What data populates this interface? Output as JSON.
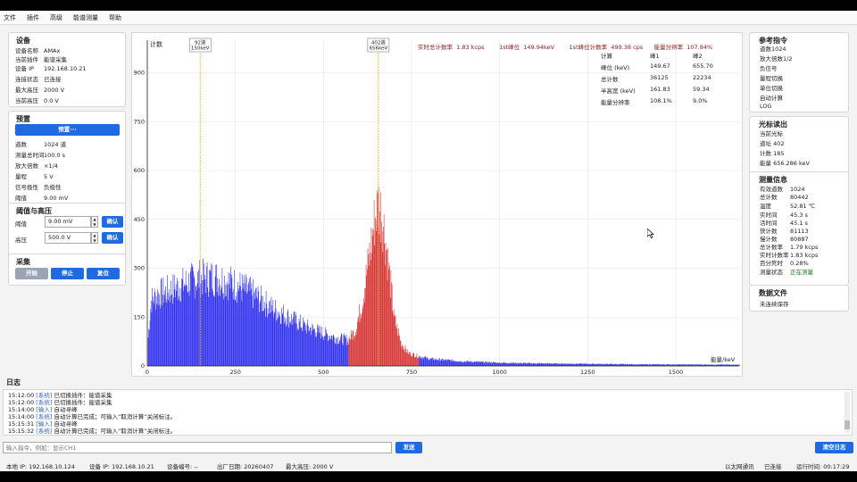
{
  "menu": [
    "文件",
    "插件",
    "高级",
    "能谱测量",
    "帮助"
  ],
  "device": {
    "title": "设备",
    "rows": [
      {
        "k": "设备名称",
        "v": "AMAx"
      },
      {
        "k": "当前插件",
        "v": "能谱采集"
      },
      {
        "k": "设备 IP",
        "v": "192.168.10.21"
      },
      {
        "k": "连接状态",
        "v": "已连接"
      },
      {
        "k": "最大高压",
        "v": "2000 V"
      },
      {
        "k": "当前高压",
        "v": "0.0 V"
      }
    ]
  },
  "preset": {
    "title": "预置",
    "button": "预置···",
    "rows": [
      {
        "k": "道数",
        "v": "1024 道"
      },
      {
        "k": "测量总时间",
        "v": "100.0 s"
      },
      {
        "k": "放大倍数",
        "v": "×1/4"
      },
      {
        "k": "量程",
        "v": "5 V"
      },
      {
        "k": "信号极性",
        "v": "负极性"
      },
      {
        "k": "阈值",
        "v": "9.00 mV"
      }
    ]
  },
  "threshold": {
    "title": "阈值与高压",
    "thr_label": "阈值",
    "thr_value": "9.00 mV",
    "hv_label": "高压",
    "hv_value": "500.0 V",
    "confirm": "确认"
  },
  "acquire": {
    "title": "采集",
    "start": "开始",
    "stop": "停止",
    "reset": "复位"
  },
  "chart_header": {
    "rate_label": "实时总计数率",
    "rate_value": "1.83 kcps",
    "peak1_label": "1st峰位",
    "peak1_value": "149.94keV",
    "count1_label": "1st峰位计数率",
    "count1_value": "499.38 cps",
    "res_label": "能量分辨率",
    "res_value": "107.84%"
  },
  "peak_table": {
    "headers": [
      "计算",
      "峰1",
      "峰2"
    ],
    "rows": [
      [
        "峰位 (keV)",
        "149.67",
        "655.70"
      ],
      [
        "总计数",
        "36125",
        "22234"
      ],
      [
        "半高宽 (keV)",
        "161.83",
        "59.34"
      ],
      [
        "能量分辨率",
        "108.1%",
        "9.0%"
      ]
    ]
  },
  "markers": [
    {
      "channel_label": "92道",
      "energy_label": "150keV",
      "energy": 150
    },
    {
      "channel_label": "402道",
      "energy_label": "656keV",
      "energy": 656
    }
  ],
  "chart_data": {
    "type": "bar",
    "ylabel": "计数",
    "xlabel": "能量/keV",
    "xlim": [
      0,
      1680
    ],
    "ylim": [
      0,
      1000
    ],
    "xticks": [
      0,
      250,
      500,
      750,
      1000,
      1250,
      1500
    ],
    "yticks": [
      0,
      150,
      300,
      450,
      600,
      750,
      900
    ],
    "grid": true,
    "series": [
      {
        "color": "#1a1af0",
        "region": [
          0,
          570
        ]
      },
      {
        "color": "#d21e1e",
        "region": [
          570,
          770
        ]
      },
      {
        "color": "#1a1af0",
        "region": [
          770,
          1680
        ]
      }
    ],
    "envelope": [
      {
        "x": 0,
        "y": 60
      },
      {
        "x": 10,
        "y": 200
      },
      {
        "x": 30,
        "y": 220
      },
      {
        "x": 60,
        "y": 230
      },
      {
        "x": 100,
        "y": 250
      },
      {
        "x": 150,
        "y": 270
      },
      {
        "x": 200,
        "y": 270
      },
      {
        "x": 250,
        "y": 250
      },
      {
        "x": 300,
        "y": 220
      },
      {
        "x": 350,
        "y": 180
      },
      {
        "x": 400,
        "y": 150
      },
      {
        "x": 450,
        "y": 120
      },
      {
        "x": 500,
        "y": 100
      },
      {
        "x": 540,
        "y": 85
      },
      {
        "x": 570,
        "y": 80
      },
      {
        "x": 590,
        "y": 110
      },
      {
        "x": 610,
        "y": 200
      },
      {
        "x": 630,
        "y": 340
      },
      {
        "x": 645,
        "y": 450
      },
      {
        "x": 656,
        "y": 500
      },
      {
        "x": 668,
        "y": 450
      },
      {
        "x": 685,
        "y": 300
      },
      {
        "x": 700,
        "y": 150
      },
      {
        "x": 720,
        "y": 70
      },
      {
        "x": 740,
        "y": 40
      },
      {
        "x": 770,
        "y": 30
      },
      {
        "x": 800,
        "y": 22
      },
      {
        "x": 900,
        "y": 14
      },
      {
        "x": 1000,
        "y": 10
      },
      {
        "x": 1100,
        "y": 8
      },
      {
        "x": 1200,
        "y": 7
      },
      {
        "x": 1400,
        "y": 5
      },
      {
        "x": 1680,
        "y": 4
      }
    ]
  },
  "ref_cmds": {
    "title": "参考指令",
    "items": [
      "道数1024",
      "放大倍数1/2",
      "负信号",
      "量程切换",
      "单位切换",
      "自动计算",
      "LOG"
    ]
  },
  "cursor": {
    "title": "光标读出",
    "current": "当前光标",
    "rows": [
      "道址 402",
      "计数 185",
      "能量 656.286 keV"
    ]
  },
  "measure": {
    "title": "测量信息",
    "rows": [
      {
        "k": "有效道数",
        "v": "1024"
      },
      {
        "k": "总计数",
        "v": "80442"
      },
      {
        "k": "温度",
        "v": "52.81 ℃"
      },
      {
        "k": "实时间",
        "v": "45.3 s"
      },
      {
        "k": "活时间",
        "v": "45.1 s"
      },
      {
        "k": "快计数",
        "v": "81113"
      },
      {
        "k": "慢计数",
        "v": "80887"
      },
      {
        "k": "总计数率",
        "v": "1.79 kcps"
      },
      {
        "k": "实时计数率",
        "v": "1.83 kcps"
      },
      {
        "k": "百分死时",
        "v": "0.28%"
      },
      {
        "k": "测量状态",
        "v": "正在测量"
      }
    ]
  },
  "datafile": {
    "title": "数据文件",
    "status": "未连续保存"
  },
  "log": {
    "title": "日志",
    "lines": [
      {
        "t": "15:12:00",
        "tag": "[系统]",
        "msg": "已切换插件：能谱采集"
      },
      {
        "t": "15:12:00",
        "tag": "[系统]",
        "msg": "已切换插件：能谱采集"
      },
      {
        "t": "15:14:00",
        "tag": "[输入]",
        "msg": "自动寻峰"
      },
      {
        "t": "15:14:00",
        "tag": "[系统]",
        "msg": "自动计算已完成；可输入“取消计算”关闭标注。"
      },
      {
        "t": "15:15:31",
        "tag": "[输入]",
        "msg": "自动寻峰"
      },
      {
        "t": "15:15:32",
        "tag": "[系统]",
        "msg": "自动计算已完成；可输入“取消计算”关闭标注。"
      }
    ],
    "placeholder": "输入指令，例如：显示CH1",
    "send": "发送",
    "clear": "清空日志"
  },
  "statusbar": {
    "local_ip": "本地 IP: 192.168.10.124",
    "dev_ip": "设备 IP: 192.168.10.21",
    "dev_no": "设备编号: --",
    "date": "出厂日期: 20260407",
    "maxhv": "最大高压: 2000 V",
    "net": "以太网通讯",
    "conn": "已连接",
    "runtime": "运行时间: 00:17:29"
  }
}
